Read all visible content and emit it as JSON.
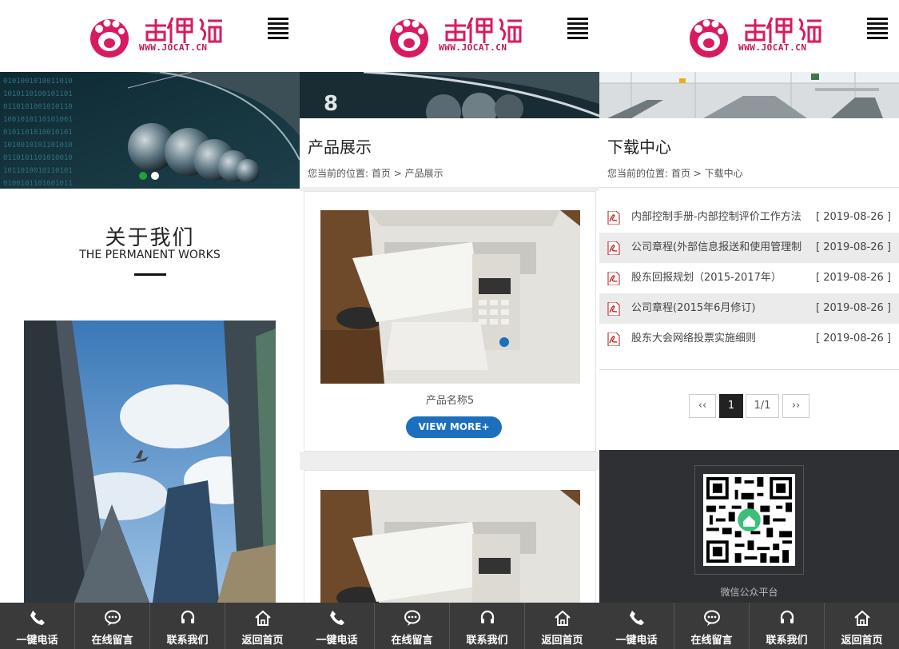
{
  "brand": {
    "logo_chinese": "奇偶猫",
    "logo_url": "WWW.JOCAT.CN",
    "accent_color": "#d81b60"
  },
  "header": {
    "menu_icon": "hamburger-menu-icon"
  },
  "home": {
    "about_title": "关于我们",
    "about_subtitle": "THE PERMANENT WORKS"
  },
  "products": {
    "title": "产品展示",
    "breadcrumb": {
      "prefix": "您当前的位置:",
      "home": "首页",
      "sep": ">",
      "current": "产品展示"
    },
    "items": [
      {
        "name": "产品名称5",
        "more": "VIEW MORE+"
      }
    ],
    "button_color": "#1c6fbd"
  },
  "downloads": {
    "title": "下载中心",
    "breadcrumb": {
      "prefix": "您当前的位置:",
      "home": "首页",
      "sep": ">",
      "current": "下载中心"
    },
    "items": [
      {
        "name": "内部控制手册-内部控制评价工作方法",
        "date": "[ 2019-08-26 ]"
      },
      {
        "name": "公司章程(外部信息报送和使用管理制",
        "date": "[ 2019-08-26 ]"
      },
      {
        "name": "股东回报规划（2015-2017年）",
        "date": "[ 2019-08-26 ]"
      },
      {
        "name": "公司章程(2015年6月修订)",
        "date": "[ 2019-08-26 ]"
      },
      {
        "name": "股东大会网络投票实施细则",
        "date": "[ 2019-08-26 ]"
      }
    ],
    "pager": {
      "prev": "‹‹",
      "current": "1",
      "info": "1/1",
      "next": "››"
    },
    "qr_label": "微信公众平台"
  },
  "bottom_nav": [
    {
      "label": "一键电话",
      "icon": "phone-icon"
    },
    {
      "label": "在线留言",
      "icon": "chat-bubble-icon"
    },
    {
      "label": "联系我们",
      "icon": "headset-icon"
    },
    {
      "label": "返回首页",
      "icon": "home-icon"
    }
  ]
}
